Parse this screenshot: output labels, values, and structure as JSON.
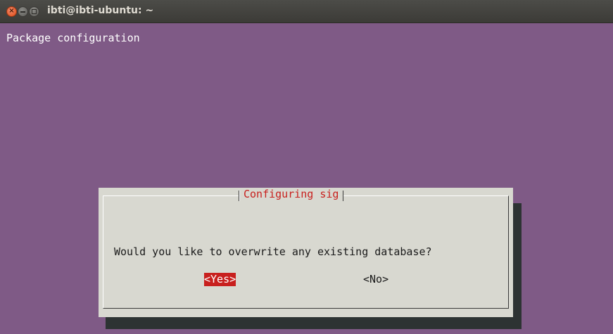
{
  "window": {
    "title": "ibti@ibti-ubuntu: ~",
    "close_glyph": "×"
  },
  "terminal": {
    "header": "Package configuration"
  },
  "dialog": {
    "title": "Configuring sig",
    "question": "Would you like to overwrite any existing database?",
    "yes_label": "<Yes>",
    "no_label": "<No>",
    "selected": "yes"
  },
  "colors": {
    "terminal_bg": "#7f5a86",
    "dialog_bg": "#d8d8d0",
    "dialog_shadow": "#2d3333",
    "accent_red": "#c8201e",
    "titlebar": "#3c3b37"
  },
  "icons": {
    "close": "close-icon",
    "minimize": "minimize-icon",
    "maximize": "maximize-icon"
  }
}
